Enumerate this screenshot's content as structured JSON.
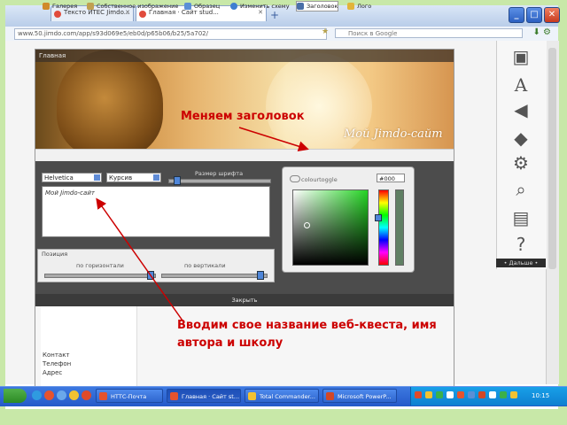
{
  "browser": {
    "tabs": [
      {
        "label": "Тексто ИТЕС Jimdo..."
      },
      {
        "label": "Главная · Сайт stud..."
      }
    ],
    "new_tab": "+",
    "url": "www.50.jimdo.com/app/s93d069e5/eb0d/p65b06/b25/5a702/",
    "search_placeholder": "Поиск в Google",
    "window_buttons": [
      "_",
      "□",
      "✕"
    ]
  },
  "site": {
    "top_label": "Главная",
    "title": "Мой Jimdo-сайт",
    "toolbar": [
      {
        "label": "Галерея",
        "color": "#d08a2a"
      },
      {
        "label": "Собственное изображение",
        "color": "#c0a050"
      },
      {
        "label": "Образец",
        "color": "#5a8fd6"
      },
      {
        "label": "Изменить схему",
        "color": "#3f7fd1"
      },
      {
        "label": "Заголовок",
        "color": "#4a6fa8"
      },
      {
        "label": "Лого",
        "color": "#e2b43a"
      }
    ],
    "font_select": "Helvetica",
    "style_select": "Курсив",
    "size_label": "Размер шрифта",
    "text_value": "Мой Jimdo-сайт",
    "position_label": "Позиция",
    "position_horizontal": "по горизонтали",
    "position_vertical": "по вертикали",
    "colour_label": "colourtoggle",
    "hex_value": "#000",
    "close_label": "Закрыть",
    "contact_title": "Контакт",
    "contact_lines": [
      "Телефон",
      "Адрес"
    ]
  },
  "annotations": {
    "header_note": "Меняем заголовок",
    "name_note": "Вводим свое название веб-квеста, имя автора и школу"
  },
  "right_panel": {
    "more_label": "• Дальше •"
  },
  "taskbar": {
    "buttons": [
      {
        "label": "НТТС-Почта",
        "active": false
      },
      {
        "label": "Главная · Сайт st...",
        "active": true
      },
      {
        "label": "Total Commander...",
        "active": false
      },
      {
        "label": "Microsoft PowerP...",
        "active": false
      }
    ],
    "clock": "10:15"
  }
}
